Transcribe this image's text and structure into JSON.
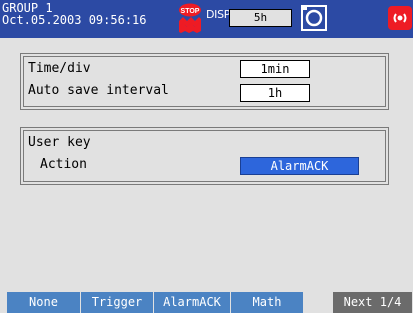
{
  "status_bar": {
    "group": "GROUP 1",
    "datetime": "Oct.05.2003 09:56:16",
    "stop_icon": "stop-icon",
    "stop_text": "STOP",
    "disp_label": "DISP",
    "disp_value": "5h",
    "camera_icon": "display-camera-icon",
    "alarm_icon": "alarm-icon"
  },
  "settings": {
    "time_div_label": "Time/div",
    "time_div_value": "1min",
    "auto_save_label": "Auto save interval",
    "auto_save_value": "1h"
  },
  "user_key": {
    "title": "User key",
    "action_label": "Action",
    "action_value": "AlarmACK"
  },
  "softkeys": [
    {
      "label": "None"
    },
    {
      "label": "Trigger"
    },
    {
      "label": "AlarmACK"
    },
    {
      "label": "Math"
    },
    {
      "label": "Next 1/4"
    }
  ],
  "colors": {
    "status_bar_bg": "#2c4aa4",
    "softkey_bg": "#4b83c3",
    "next_key_bg": "#6b6b6b",
    "selected_bg": "#2d66dc",
    "alarm": "#ee1b24",
    "background": "#e1e1e1"
  }
}
